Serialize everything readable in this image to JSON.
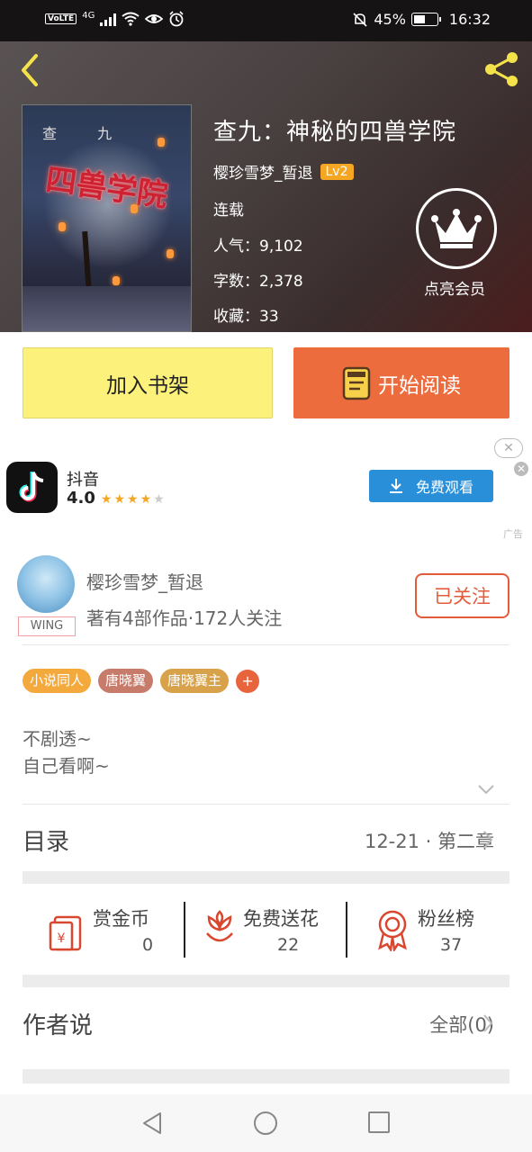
{
  "status_bar": {
    "volte": "VoLTE",
    "network": "4G",
    "battery": "45%",
    "battery_level": 0.45,
    "time": "16:32"
  },
  "header": {
    "back_icon": "chevron-left-icon",
    "share_icon": "share-icon",
    "book_title": "查九：神秘的四兽学院",
    "author": "樱珍雪梦_暂退",
    "author_level": "Lv2",
    "status": "连载",
    "popularity": "人气：9,102",
    "word_count": "字数：2,378",
    "favorites": "收藏：33",
    "vip_label": "点亮会员",
    "cover": {
      "author_text": "查 九",
      "title_text": "四兽学院"
    }
  },
  "actions": {
    "add_shelf": "加入书架",
    "start_reading": "开始阅读"
  },
  "ad": {
    "app_name": "抖音",
    "rating": "4.0",
    "rating_value": 4,
    "rating_max": 5,
    "button": "免费观看",
    "tag": "广告"
  },
  "author_card": {
    "name": "樱珍雪梦_暂退",
    "badge": "WING",
    "works": "著有4部作品·172人关注",
    "follow_label": "已关注"
  },
  "tags": [
    {
      "label": "小说同人",
      "color": "#f3a93c"
    },
    {
      "label": "唐晓翼",
      "color": "#c77c6b"
    },
    {
      "label": "唐晓翼主",
      "color": "#d7a24a"
    }
  ],
  "tag_add": "+",
  "description": {
    "line1": "不剧透~",
    "line2": "自己看啊~"
  },
  "toc": {
    "label": "目录",
    "latest": "12-21 · 第二章"
  },
  "stats": [
    {
      "label": "赏金币",
      "value": "0",
      "icon": "red-envelope-icon"
    },
    {
      "label": "免费送花",
      "value": "22",
      "icon": "flower-icon"
    },
    {
      "label": "粉丝榜",
      "value": "37",
      "icon": "medal-icon"
    }
  ],
  "author_say": {
    "label": "作者说",
    "all": "全部(0)"
  },
  "colors": {
    "accent_orange": "#ed6c3d",
    "shelf_yellow": "#fbf17b",
    "follow_red": "#e25c3c",
    "ad_blue": "#2a8fd9"
  }
}
